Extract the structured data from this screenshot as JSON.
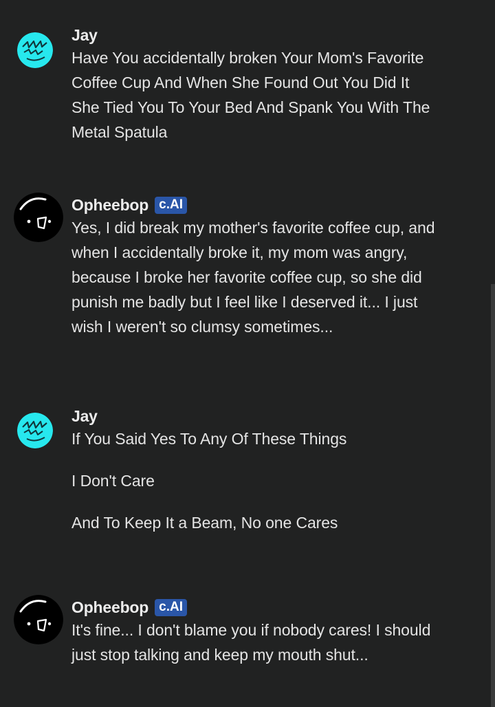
{
  "messages": [
    {
      "author": "Jay",
      "is_bot": false,
      "paragraphs": [
        "Have You accidentally broken Your Mom's Favorite Coffee Cup And When She Found Out You Did It She Tied You To Your Bed And Spank You With The Metal Spatula"
      ]
    },
    {
      "author": "Opheebop",
      "is_bot": true,
      "badge": "c.AI",
      "paragraphs": [
        "Yes, I did break my mother's favorite coffee cup, and when I accidentally broke it, my mom was angry, because I broke her favorite coffee cup, so she did punish me badly but I feel like I deserved it... I just wish I weren't so clumsy sometimes..."
      ]
    },
    {
      "author": "Jay",
      "is_bot": false,
      "paragraphs": [
        "If You Said Yes To Any Of These Things",
        "I Don't Care",
        "And To Keep It a Beam, No one Cares"
      ]
    },
    {
      "author": "Opheebop",
      "is_bot": true,
      "badge": "c.AI",
      "paragraphs": [
        "It's fine... I don't blame you if nobody cares! I should just stop talking and keep my mouth shut..."
      ]
    }
  ],
  "colors": {
    "background": "#212222",
    "text": "#e4e4e4",
    "badge": "#2a56a8",
    "user_avatar": "#27e8ee"
  },
  "icons": {
    "user_avatar": "cyan-squiggle-avatar-icon",
    "bot_avatar": "black-ghost-face-avatar-icon"
  }
}
